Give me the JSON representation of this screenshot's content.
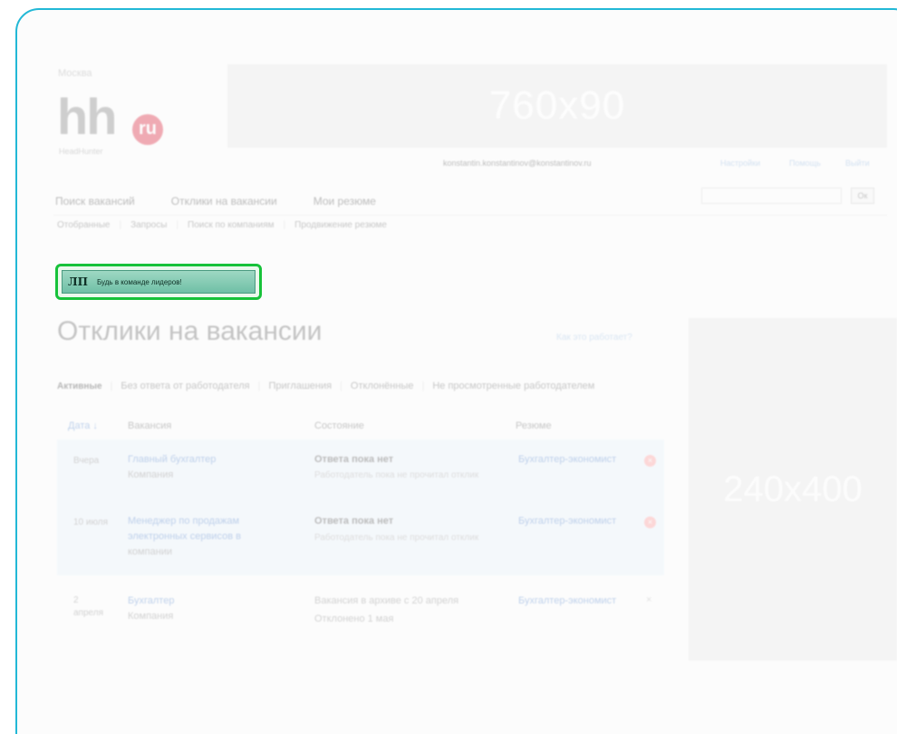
{
  "header": {
    "region": "Москва",
    "logo": {
      "main": "hh",
      "badge": "ru",
      "sub": "HeadHunter"
    },
    "banner_top": "760x90",
    "user_email": "konstantin.konstantinov@konstantinov.ru",
    "user_links": [
      "Настройки",
      "Помощь",
      "Выйти"
    ]
  },
  "main_nav": [
    "Поиск вакансий",
    "Отклики на вакансии",
    "Мои резюме"
  ],
  "search": {
    "button": "Ок"
  },
  "sub_nav": [
    "Отобранные",
    "Запросы",
    "Поиск по компаниям",
    "Продвижение резюме"
  ],
  "promo": {
    "mark": "ЛП",
    "text": "Будь в команде лидеров!"
  },
  "page": {
    "title": "Отклики на вакансии",
    "help_link": "Как это работает?"
  },
  "tabs": [
    "Активные",
    "Без ответа от работодателя",
    "Приглашения",
    "Отклонённые",
    "Не просмотренные работодателем"
  ],
  "table": {
    "columns": {
      "date": "Дата ↓",
      "vacancy": "Вакансия",
      "state": "Состояние",
      "resume": "Резюме"
    },
    "rows": [
      {
        "date": "Вчера",
        "vacancy_lines": [
          "Главный бухгалтер",
          "Компания"
        ],
        "state": "Ответа пока нет",
        "state_sub": "Работодатель пока не прочитал отклик",
        "resume": "Бухгалтер-экономист",
        "delete": "×"
      },
      {
        "date": "10 июля",
        "vacancy_lines": [
          "Менеджер по продажам",
          "электронных сервисов в",
          "компании"
        ],
        "state": "Ответа пока нет",
        "state_sub": "Работодатель пока не прочитал отклик",
        "resume": "Бухгалтер-экономист",
        "delete": "×"
      },
      {
        "date": [
          "2",
          "апреля"
        ],
        "vacancy_lines": [
          "Бухгалтер",
          "Компания"
        ],
        "state_lines": [
          "Вакансия в архиве с 20 апреля",
          "Отклонено 1 мая"
        ],
        "resume": "Бухгалтер-экономист",
        "delete": "×"
      }
    ]
  },
  "banner_side": "240x400",
  "colors": {
    "frame": "#22b8d6",
    "promo_border": "#17c23a",
    "link": "#3b74c6",
    "logo_badge": "#d6001c"
  }
}
